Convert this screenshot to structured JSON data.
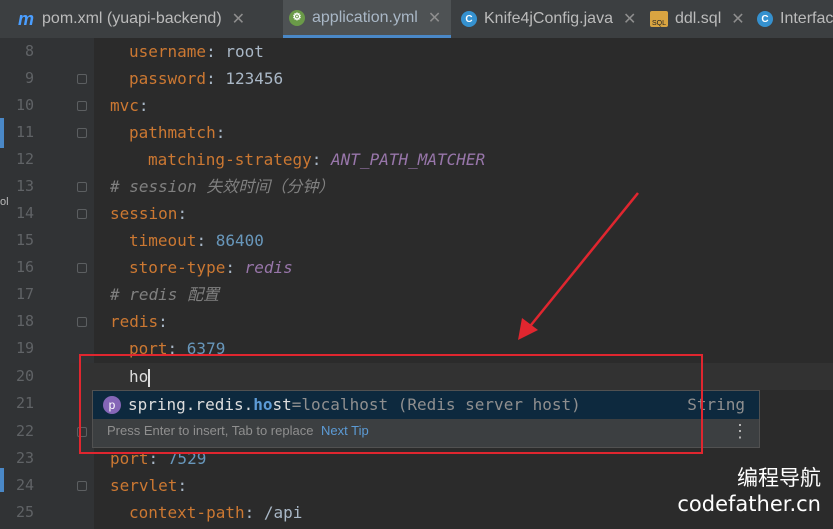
{
  "tabs": [
    {
      "label": "pom.xml (yuapi-backend)",
      "icon": "maven-icon",
      "active": false
    },
    {
      "label": "application.yml",
      "icon": "yml-icon",
      "active": true
    },
    {
      "label": "Knife4jConfig.java",
      "icon": "class-icon",
      "active": false
    },
    {
      "label": "ddl.sql",
      "icon": "sql-icon",
      "active": false
    },
    {
      "label": "Interfac",
      "icon": "class-icon",
      "active": false
    }
  ],
  "tab_close_glyph": "✕",
  "left_strip_label": "ol",
  "lines": [
    {
      "n": "8",
      "key": "username",
      "sep": ": ",
      "value": "root",
      "vclass": "val"
    },
    {
      "n": "9",
      "key": "password",
      "sep": ": ",
      "value": "123456",
      "vclass": "val"
    },
    {
      "n": "10",
      "key": "mvc",
      "sep": ":",
      "value": "",
      "vclass": "val"
    },
    {
      "n": "11",
      "key": "pathmatch",
      "sep": ":",
      "value": "",
      "vclass": "val"
    },
    {
      "n": "12",
      "key": "matching-strategy",
      "sep": ": ",
      "value": "ANT_PATH_MATCHER",
      "vclass": "enum"
    },
    {
      "n": "13",
      "comment": "# session 失效时间（分钟）"
    },
    {
      "n": "14",
      "key": "session",
      "sep": ":",
      "value": "",
      "vclass": "val"
    },
    {
      "n": "15",
      "key": "timeout",
      "sep": ": ",
      "value": "86400",
      "vclass": "num"
    },
    {
      "n": "16",
      "key": "store-type",
      "sep": ": ",
      "value": "redis",
      "vclass": "enum"
    },
    {
      "n": "17",
      "comment": "# redis 配置"
    },
    {
      "n": "18",
      "key": "redis",
      "sep": ":",
      "value": "",
      "vclass": "val"
    },
    {
      "n": "19",
      "key": "port",
      "sep": ": ",
      "value": "6379",
      "vclass": "num"
    },
    {
      "n": "20",
      "typed": "ho"
    },
    {
      "n": "21"
    },
    {
      "n": "22"
    },
    {
      "n": "23",
      "key": "port",
      "sep": ": ",
      "value": "7529",
      "vclass": "num"
    },
    {
      "n": "24",
      "key": "servlet",
      "sep": ":",
      "value": "",
      "vclass": "val"
    },
    {
      "n": "25",
      "key": "context-path",
      "sep": ": ",
      "value": "/api",
      "vclass": "val"
    }
  ],
  "autocomplete": {
    "icon_letter": "p",
    "prefix": "spring.redis.",
    "match": "ho",
    "rest": "st",
    "default_value": "=localhost",
    "description": " (Redis server host)",
    "type": "String",
    "hint": "Press Enter to insert, Tab to replace",
    "next_tip": "Next Tip",
    "menu_glyph": "⋮"
  },
  "watermark": {
    "line1": "编程导航",
    "line2": "codefather.cn"
  },
  "colors": {
    "annotation_red": "#e0262f",
    "key_orange": "#cc7832",
    "number_blue": "#6897bb",
    "enum_purple": "#9876aa"
  }
}
